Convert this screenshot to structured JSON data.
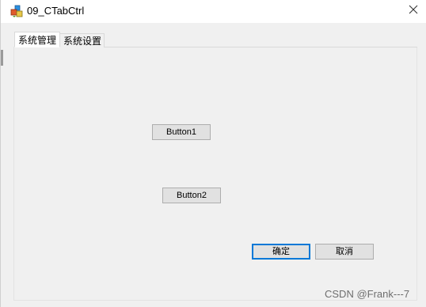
{
  "window": {
    "title": "09_CTabCtrl",
    "close_glyph": "✕"
  },
  "tabs": [
    {
      "label": "系统管理",
      "active": true
    },
    {
      "label": "系统设置",
      "active": false
    }
  ],
  "buttons": {
    "button1": "Button1",
    "button2": "Button2",
    "ok": "确定",
    "cancel": "取消"
  },
  "watermark": "CSDN @Frank---7",
  "colors": {
    "accent": "#0078d7"
  }
}
